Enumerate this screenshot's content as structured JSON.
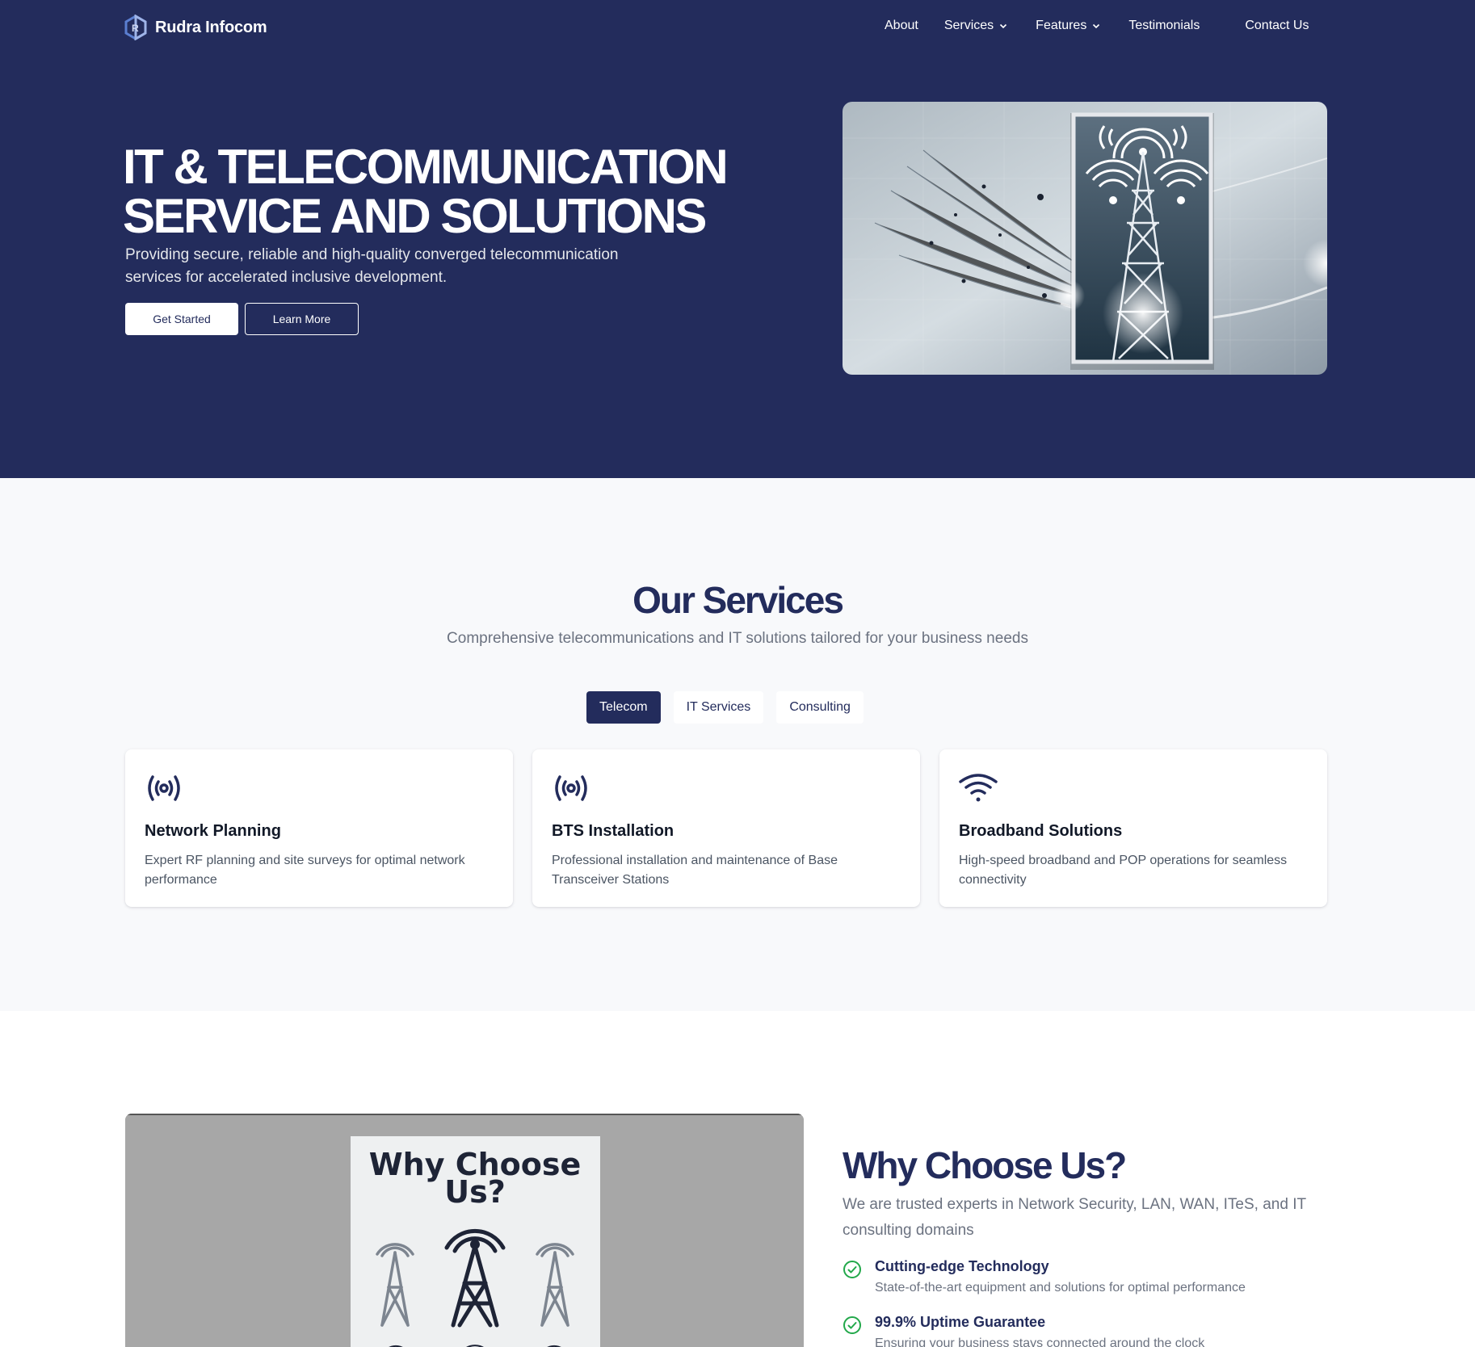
{
  "brand": {
    "name": "Rudra Infocom"
  },
  "nav": {
    "about": "About",
    "services": "Services",
    "features": "Features",
    "testimonials": "Testimonials",
    "contact": "Contact Us"
  },
  "hero": {
    "title_line1": "IT & TELECOMMUNICATION",
    "title_line2": "SERVICE AND SOLUTIONS",
    "subtitle": "Providing secure, reliable and high-quality converged telecommunication services for accelerated inclusive development.",
    "primary_button": "Get Started",
    "secondary_button": "Learn More"
  },
  "services": {
    "title": "Our Services",
    "subtitle": "Comprehensive telecommunications and IT solutions tailored for your business needs",
    "tabs": [
      {
        "label": "Telecom",
        "active": true
      },
      {
        "label": "IT Services",
        "active": false
      },
      {
        "label": "Consulting",
        "active": false
      }
    ],
    "cards": [
      {
        "icon": "broadcast-icon",
        "title": "Network Planning",
        "description": "Expert RF planning and site surveys for optimal network performance"
      },
      {
        "icon": "broadcast-icon",
        "title": "BTS Installation",
        "description": "Professional installation and maintenance of Base Transceiver Stations"
      },
      {
        "icon": "wifi-icon",
        "title": "Broadband Solutions",
        "description": "High-speed broadband and POP operations for seamless connectivity"
      }
    ]
  },
  "why": {
    "image_heading_line1": "Why Choose",
    "image_heading_line2": "Us?",
    "title": "Why Choose Us?",
    "subtitle": "We are trusted experts in Network Security, LAN, WAN, ITeS, and IT consulting domains",
    "features": [
      {
        "title": "Cutting-edge Technology",
        "description": "State-of-the-art equipment and solutions for optimal performance"
      },
      {
        "title": "99.9% Uptime Guarantee",
        "description": "Ensuring your business stays connected around the clock"
      }
    ]
  },
  "colors": {
    "primary": "#232c5c",
    "check": "#22a84a",
    "section_bg": "#f8f9fb"
  }
}
